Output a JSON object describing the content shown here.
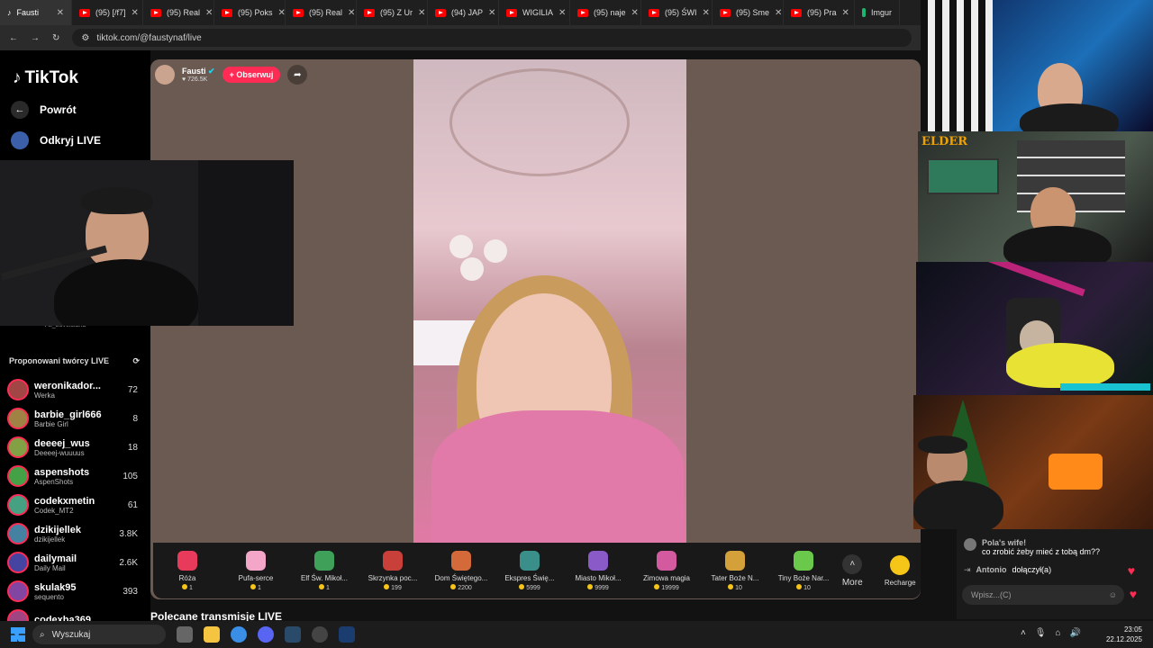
{
  "browser": {
    "tabs": [
      {
        "label": "Fausti",
        "type": "tiktok",
        "active": true
      },
      {
        "label": "(95) [/f7]",
        "type": "youtube"
      },
      {
        "label": "(95) Real",
        "type": "youtube"
      },
      {
        "label": "(95) Poks",
        "type": "youtube"
      },
      {
        "label": "(95) Real",
        "type": "youtube"
      },
      {
        "label": "(95) Z Ur",
        "type": "youtube"
      },
      {
        "label": "(94) JAP",
        "type": "youtube"
      },
      {
        "label": "WIGILIA",
        "type": "youtube"
      },
      {
        "label": "(95) naje",
        "type": "youtube"
      },
      {
        "label": "(95) ŚWI",
        "type": "youtube"
      },
      {
        "label": "(95) Sme",
        "type": "youtube"
      },
      {
        "label": "(95) Pra",
        "type": "youtube"
      },
      {
        "label": "Imgur",
        "type": "imgur"
      }
    ],
    "url": "tiktok.com/@faustynaf/live"
  },
  "sidebar": {
    "logo": "TikTok",
    "back_label": "Powrót",
    "discover_label": "Odkryj LIVE",
    "partial_item": "Ali_Lovelsland",
    "suggested_title": "Proponowani twórcy LIVE",
    "creators": [
      {
        "name": "weronikador...",
        "sub": "Werka",
        "count": "72"
      },
      {
        "name": "barbie_girl666",
        "sub": "Barbie Girl",
        "count": "8"
      },
      {
        "name": "deeeej_wus",
        "sub": "Deeeej-wuuuus",
        "count": "18"
      },
      {
        "name": "aspenshots",
        "sub": "AspenShots",
        "count": "105"
      },
      {
        "name": "codekxmetin",
        "sub": "Codek_MT2",
        "count": "61"
      },
      {
        "name": "dzikijellek",
        "sub": "dzikijellek",
        "count": "3.8K"
      },
      {
        "name": "dailymail",
        "sub": "Daily Mail",
        "count": "2.6K"
      },
      {
        "name": "skulak95",
        "sub": "sequento",
        "count": "393"
      },
      {
        "name": "codexba369",
        "sub": "",
        "count": ""
      }
    ]
  },
  "host": {
    "name": "Fausti",
    "likes": "726.5K",
    "follow_label": "+ Obserwuj"
  },
  "gifts": [
    {
      "name": "Róża",
      "price": "1",
      "color": "#e83a5a"
    },
    {
      "name": "Pufa-serce",
      "price": "1",
      "color": "#f3a6c8"
    },
    {
      "name": "Elf Św. Mikoł...",
      "price": "1",
      "color": "#3fa05a"
    },
    {
      "name": "Skrzynka poc...",
      "price": "199",
      "color": "#c9403a"
    },
    {
      "name": "Dom Świętego...",
      "price": "2200",
      "color": "#d46a3a"
    },
    {
      "name": "Ekspres Świę...",
      "price": "5999",
      "color": "#3a8f8a"
    },
    {
      "name": "Miasto Mikoł...",
      "price": "9999",
      "color": "#8a5ac9"
    },
    {
      "name": "Zimowa magia",
      "price": "19999",
      "color": "#d45aa0"
    },
    {
      "name": "Tater Boże N...",
      "price": "10",
      "color": "#d4a03a"
    },
    {
      "name": "Tiny Boże Nar...",
      "price": "10",
      "color": "#6ac94a"
    }
  ],
  "more_label": "More",
  "recharge_label": "Recharge",
  "below_title": "Polecane transmisje LIVE",
  "overlay": {
    "elder_tag": "ELDER"
  },
  "chat": {
    "messages": [
      {
        "user": "Pola's wife!",
        "text": "co zrobić żeby mieć z tobą dm??"
      },
      {
        "user": "Antonio",
        "text": "dołączył(a)"
      }
    ],
    "input_placeholder": "Wpisz...(C)"
  },
  "taskbar": {
    "search_label": "Wyszukaj",
    "time": "23:05",
    "date": "22.12.2025"
  },
  "colors": {
    "accent": "#fe2c55",
    "stream_bg": "#6b5a52"
  }
}
